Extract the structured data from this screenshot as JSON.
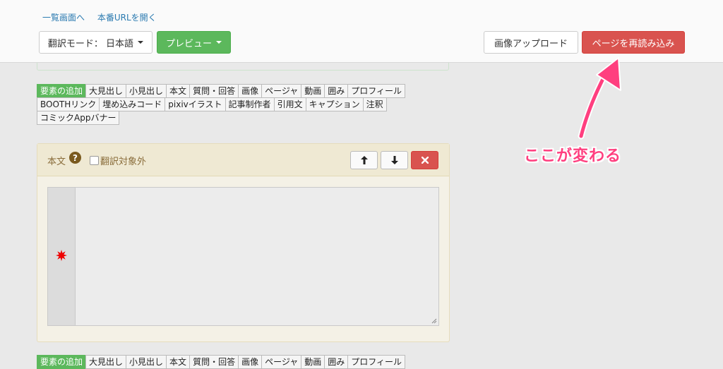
{
  "header": {
    "links": [
      "一覧画面へ",
      "本番URLを開く"
    ],
    "mode_button": "翻訳モード： 日本語",
    "preview_button": "プレビュー",
    "upload_button": "画像アップロード",
    "reload_button": "ページを再読み込み"
  },
  "tags": {
    "first": [
      "要素の追加",
      "大見出し",
      "小見出し",
      "本文",
      "質問・回答",
      "画像",
      "ページャ",
      "動画",
      "囲み",
      "プロフィール",
      "BOOTHリンク",
      "埋め込みコード",
      "pixivイラスト",
      "記事制作者",
      "引用文",
      "キャプション",
      "注釈",
      "コミックAppバナー"
    ],
    "second": [
      "要素の追加",
      "大見出し",
      "小見出し",
      "本文",
      "質問・回答",
      "画像",
      "ページャ",
      "動画",
      "囲み",
      "プロフィール"
    ]
  },
  "panel": {
    "title": "本文",
    "help_icon": "?",
    "exclude_label": "翻訳対象外",
    "icons": {
      "up": "arrow-up-icon",
      "down": "arrow-down-icon",
      "delete": "close-icon"
    }
  },
  "annotation": {
    "callout": "ここが変わる",
    "color": "#ff3f7f"
  }
}
